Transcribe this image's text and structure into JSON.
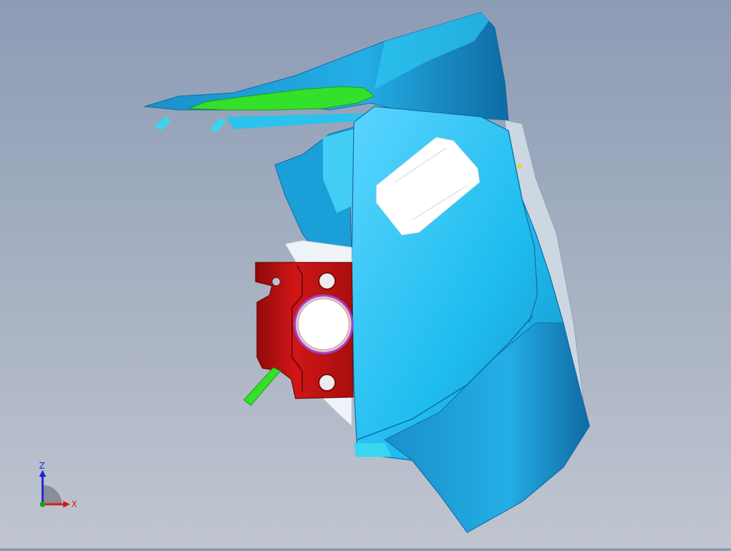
{
  "viewport": {
    "background_top": "#8c9cb5",
    "background_bottom": "#c0c5d0"
  },
  "model": {
    "colors": {
      "housing_blue": "#1fbdee",
      "housing_dark": "#1a8fc8",
      "edge_highlight": "#6fe0ff",
      "bracket_red": "#c41212",
      "bracket_dark": "#8f0a0a",
      "rib_green": "#33e02a",
      "label_white": "#ffffff",
      "ring_purple": "#a040d0"
    }
  },
  "triad": {
    "z_label": "Z",
    "x_label": "X",
    "z_color": "#1a22d6",
    "x_color": "#d61a1a",
    "y_color": "#1aa01a"
  }
}
